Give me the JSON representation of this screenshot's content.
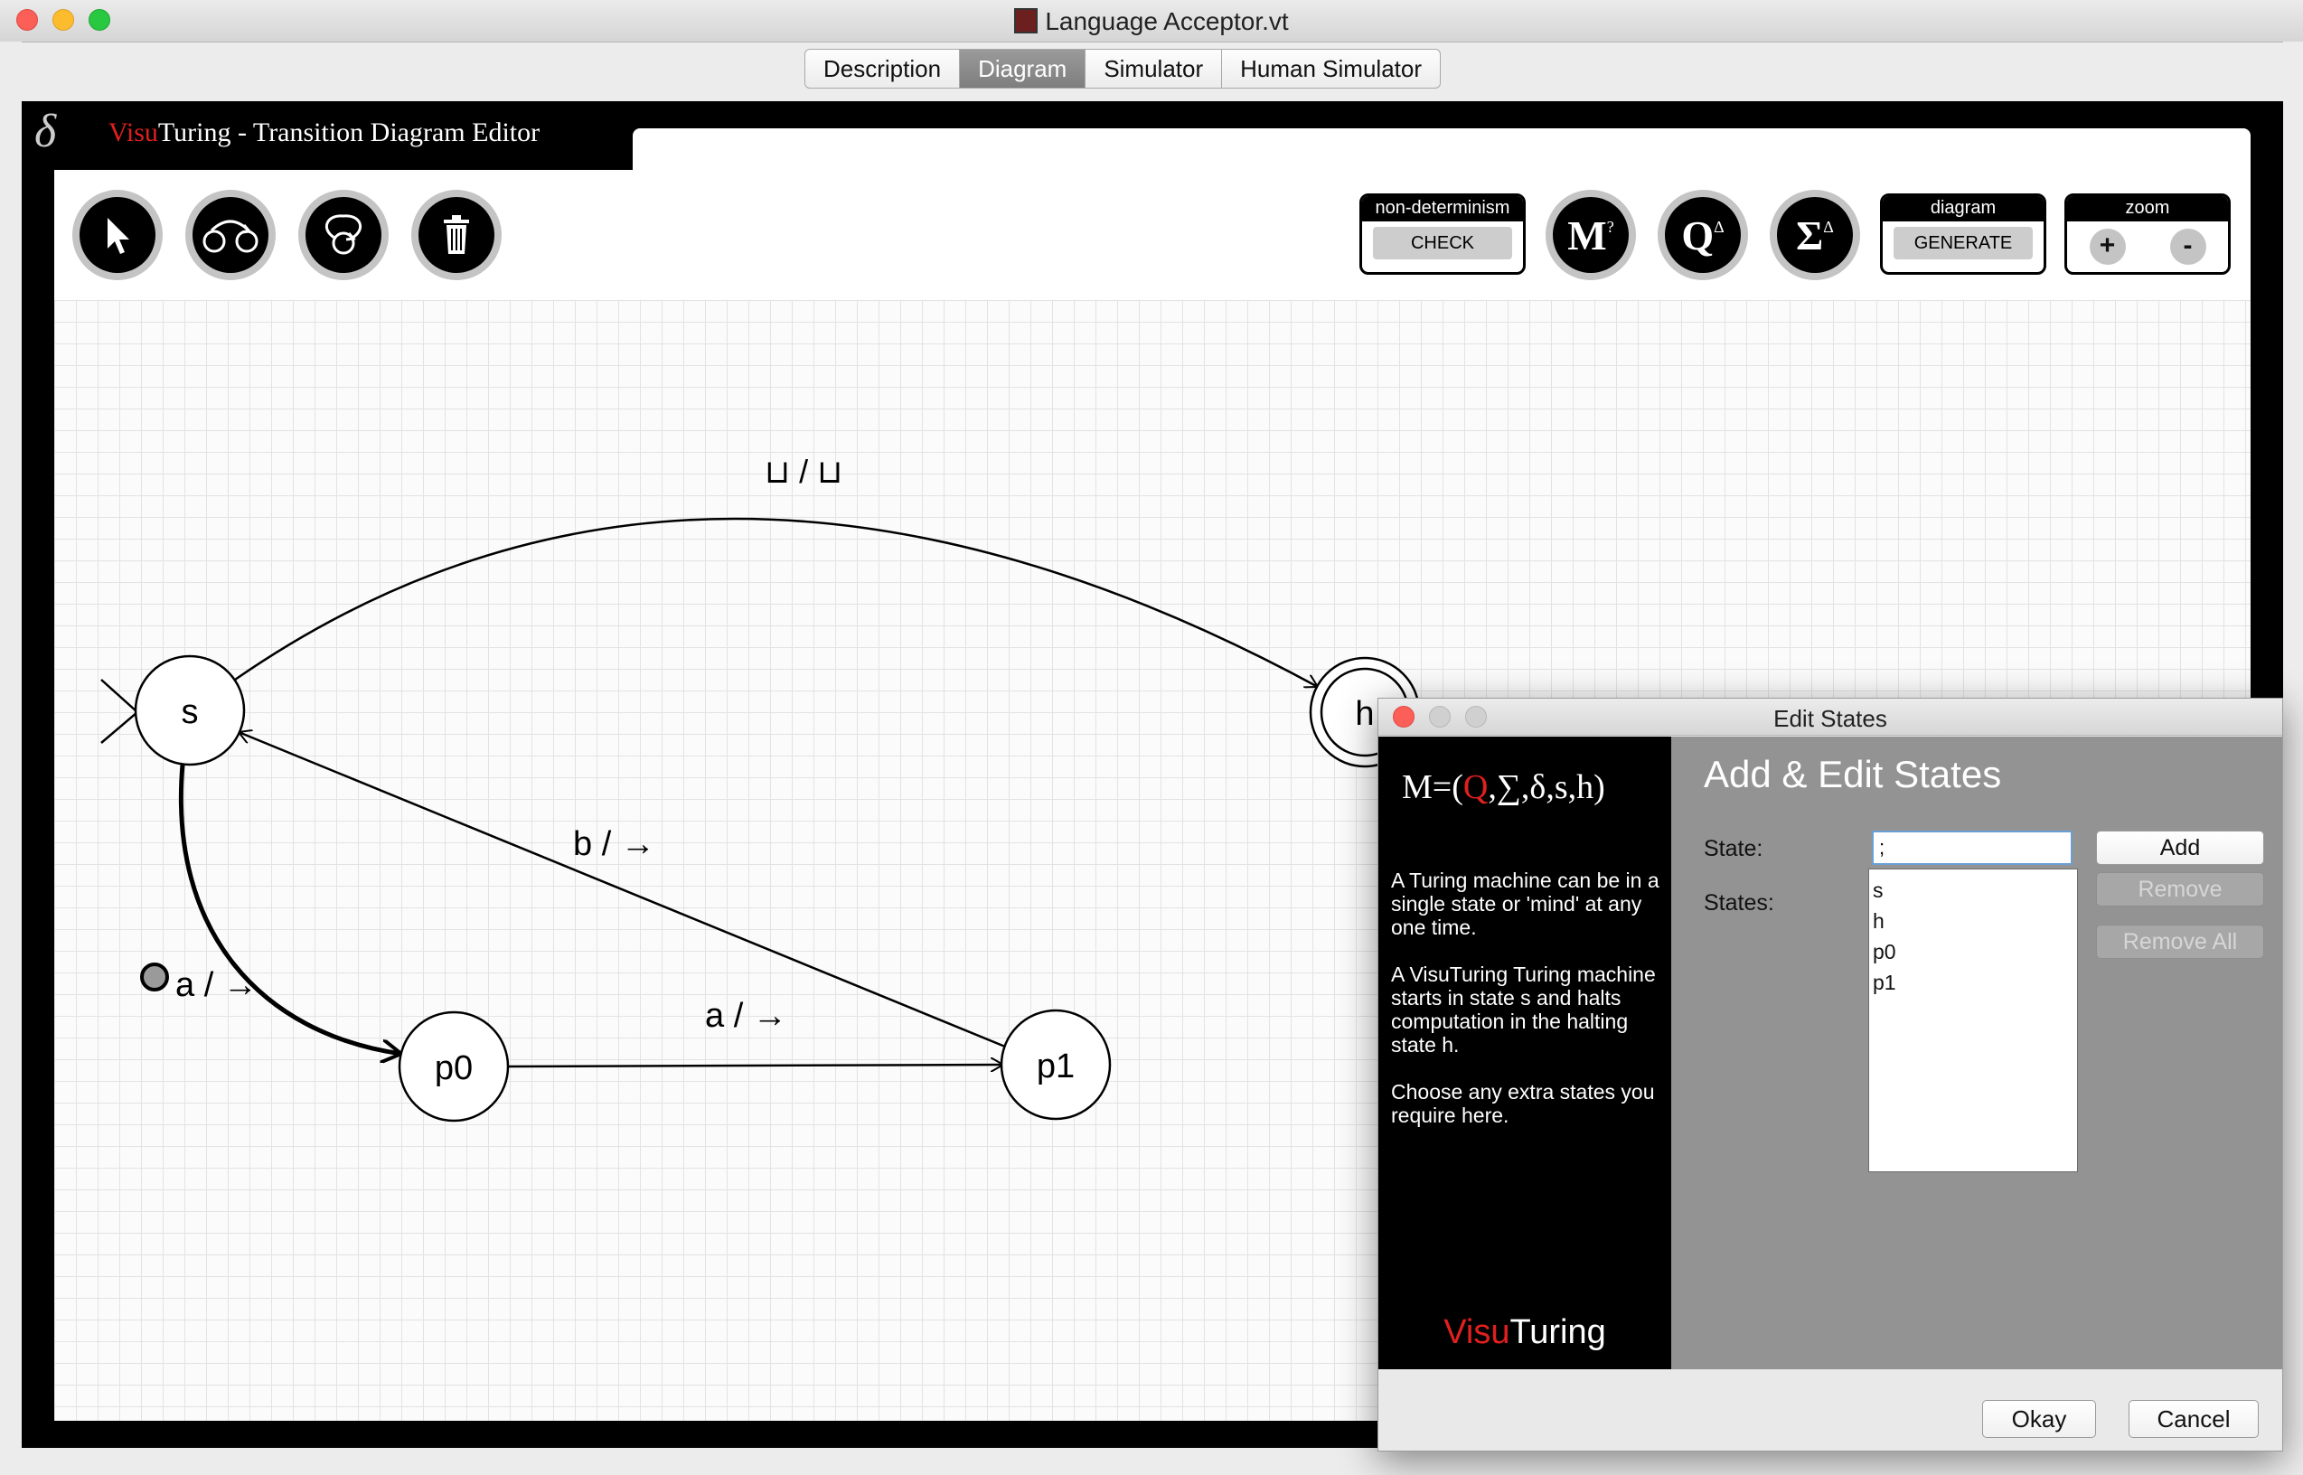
{
  "window": {
    "title": "Language Acceptor.vt"
  },
  "tabs": [
    {
      "label": "Description",
      "active": false
    },
    {
      "label": "Diagram",
      "active": true
    },
    {
      "label": "Simulator",
      "active": false
    },
    {
      "label": "Human Simulator",
      "active": false
    }
  ],
  "editor": {
    "logo_glyph": "δ",
    "title_brand_red": "Visu",
    "title_rest": "Turing - Transition Diagram Editor"
  },
  "toolbar": {
    "tools": [
      {
        "icon": "select-arrow-icon"
      },
      {
        "icon": "add-transition-icon"
      },
      {
        "icon": "add-loop-icon"
      },
      {
        "icon": "trash-icon"
      }
    ],
    "nondeterminism": {
      "header": "non-determinism",
      "button": "CHECK"
    },
    "machine": {
      "glyph": "M",
      "sup": "?"
    },
    "states": {
      "glyph": "Q",
      "sup": "Δ"
    },
    "alphabet": {
      "glyph": "Σ",
      "sup": "Δ"
    },
    "diagram": {
      "header": "diagram",
      "button": "GENERATE"
    },
    "zoom": {
      "header": "zoom",
      "in": "+",
      "out": "-"
    }
  },
  "diagram": {
    "states": [
      {
        "name": "s",
        "start": true,
        "halting": false
      },
      {
        "name": "h",
        "start": false,
        "halting": true
      },
      {
        "name": "p0",
        "start": false,
        "halting": false
      },
      {
        "name": "p1",
        "start": false,
        "halting": false
      }
    ],
    "transitions": [
      {
        "from": "s",
        "to": "h",
        "label": "⊔ / ⊔",
        "selected": false
      },
      {
        "from": "p1",
        "to": "s",
        "label": "b / →",
        "selected": false
      },
      {
        "from": "s",
        "to": "p0",
        "label": "a / →",
        "selected": true
      },
      {
        "from": "p0",
        "to": "p1",
        "label": "a / →",
        "selected": false
      }
    ]
  },
  "dialog": {
    "title": "Edit States",
    "formula_prefix": "M=(",
    "formula_q": "Q",
    "formula_suffix": ",∑,δ,s,h)",
    "help": [
      "A Turing machine can be in a single state or 'mind' at any one time.",
      "A VisuTuring Turing machine starts in state s and halts computation in the halting state h.",
      "Choose any extra states you require here."
    ],
    "logo_red": "Visu",
    "logo_rest": "Turing",
    "heading": "Add & Edit States",
    "state_label": "State:",
    "state_value": ";",
    "states_label": "States:",
    "states": [
      "s",
      "h",
      "p0",
      "p1"
    ],
    "add_button": "Add",
    "remove_button": "Remove",
    "remove_all_button": "Remove All",
    "okay_button": "Okay",
    "cancel_button": "Cancel"
  }
}
